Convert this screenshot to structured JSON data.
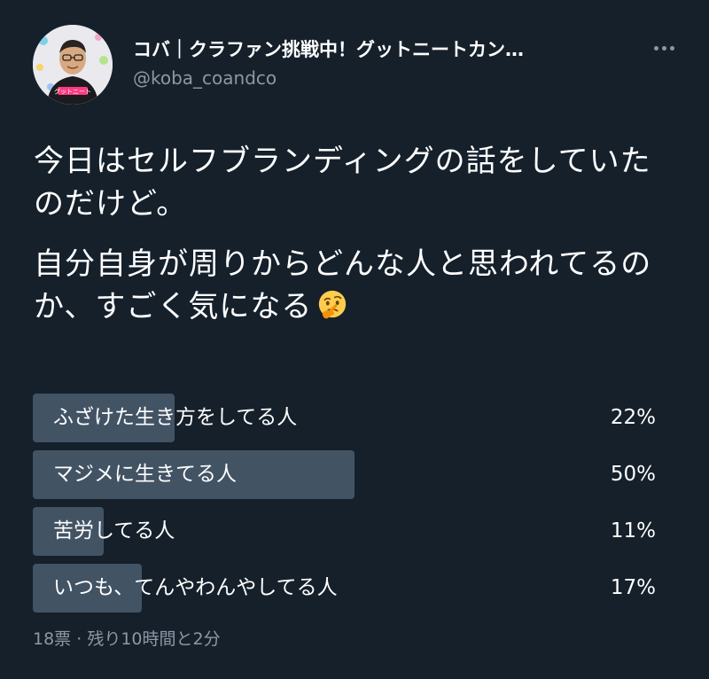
{
  "user": {
    "display_name": "コバ｜クラファン挑戦中！グットニートカン…",
    "handle": "@koba_coandco",
    "avatar_shirt_text": "グットニート"
  },
  "tweet": {
    "paragraphs": [
      "今日はセルフブランディングの話をしていたのだけど。",
      "自分自身が周りからどんな人と思われてるのか、すごく気になる"
    ],
    "emoji": "thinking-face"
  },
  "poll": {
    "options": [
      {
        "label": "ふざけた生き方をしてる人",
        "percent_text": "22%",
        "percent": 22
      },
      {
        "label": "マジメに生きてる人",
        "percent_text": "50%",
        "percent": 50
      },
      {
        "label": "苦労してる人",
        "percent_text": "11%",
        "percent": 11
      },
      {
        "label": "いつも、てんやわんやしてる人",
        "percent_text": "17%",
        "percent": 17
      }
    ],
    "votes": "18票",
    "separator": "·",
    "time_left": "残り10時間と2分"
  },
  "colors": {
    "background": "#15202b",
    "bar": "#425364",
    "secondary_text": "#8b98a5"
  }
}
